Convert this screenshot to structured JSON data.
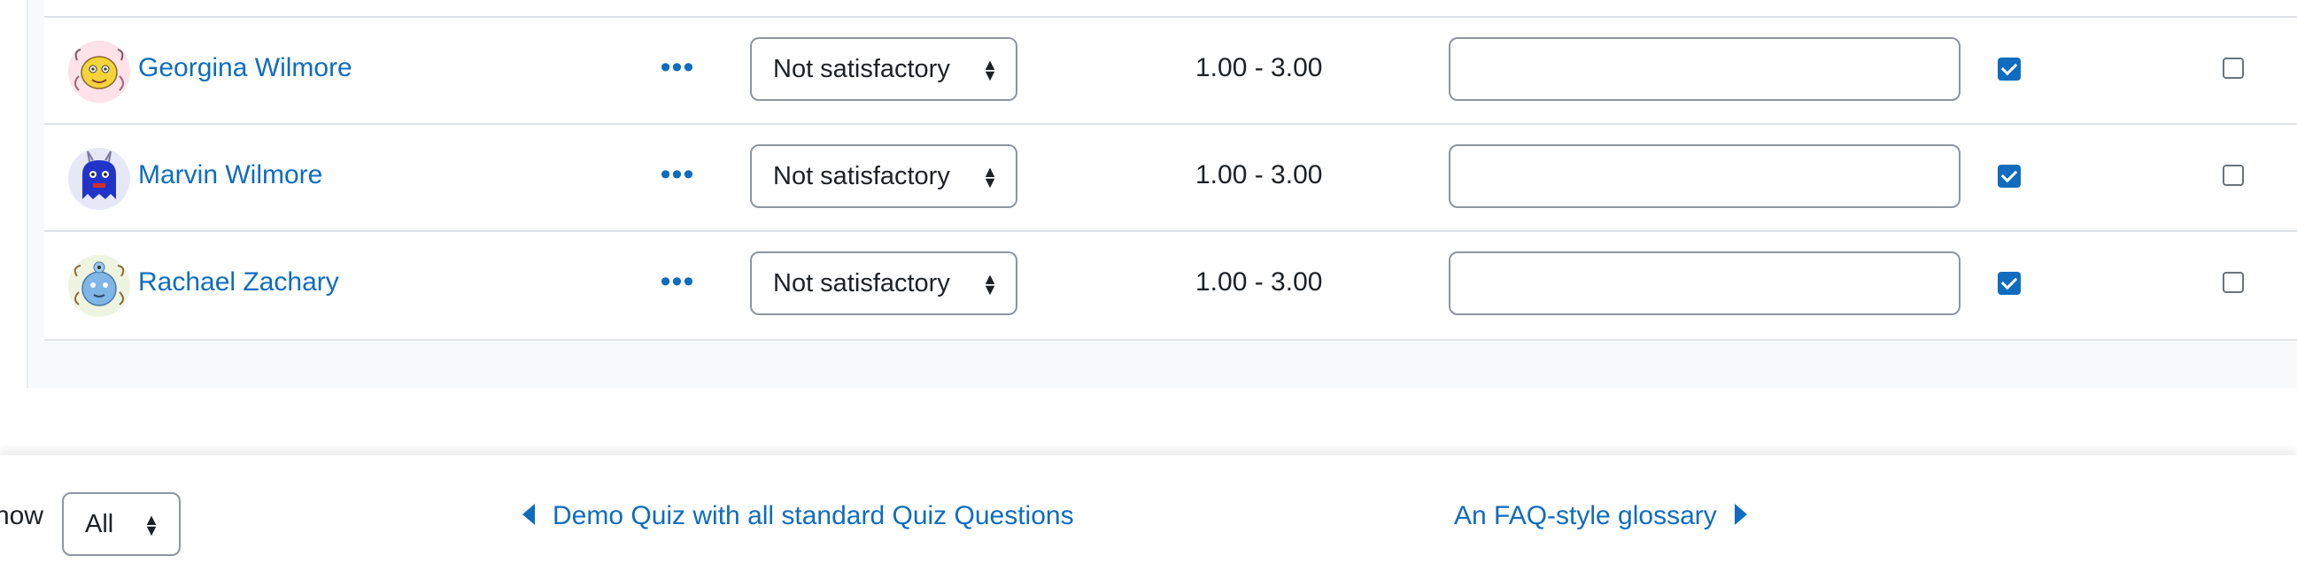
{
  "grading_rows": [
    {
      "name": "Georgina Wilmore",
      "actions_icon": "ellipsis-icon",
      "grade": "Not satisfactory",
      "range": "1.00 - 3.00",
      "feedback": "",
      "checked_a": true,
      "checked_b": false,
      "avatar": "monster-avatar-yellow"
    },
    {
      "name": "Marvin Wilmore",
      "actions_icon": "ellipsis-icon",
      "grade": "Not satisfactory",
      "range": "1.00 - 3.00",
      "feedback": "",
      "checked_a": true,
      "checked_b": false,
      "avatar": "monster-avatar-blue"
    },
    {
      "name": "Rachael Zachary",
      "actions_icon": "ellipsis-icon",
      "grade": "Not satisfactory",
      "range": "1.00 - 3.00",
      "feedback": "",
      "checked_a": true,
      "checked_b": false,
      "avatar": "monster-avatar-lightblue"
    }
  ],
  "grade_options": [
    "Not satisfactory"
  ],
  "footer": {
    "show_label": "how",
    "show_value": "All",
    "prev_link": "Demo Quiz with all standard Quiz Questions",
    "next_link": "An FAQ-style glossary"
  },
  "colors": {
    "link": "#0f6cbf",
    "checkbox": "#0f6cbf",
    "panel_bg": "#f8f9fa",
    "border": "#dee2e6"
  }
}
